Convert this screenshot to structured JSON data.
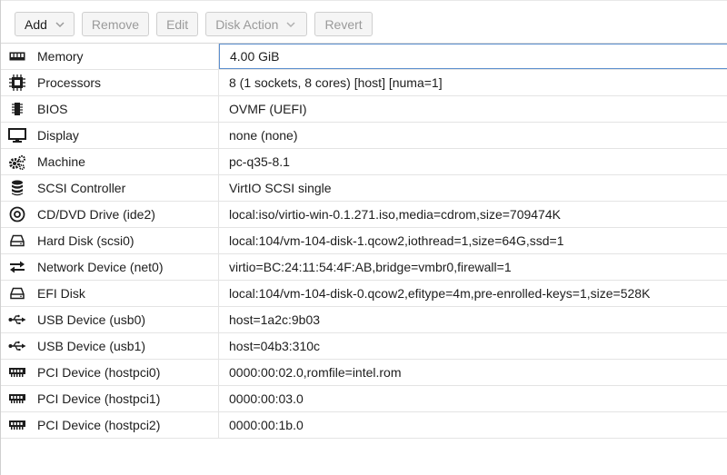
{
  "toolbar": {
    "add_label": "Add",
    "remove_label": "Remove",
    "edit_label": "Edit",
    "disk_action_label": "Disk Action",
    "revert_label": "Revert"
  },
  "hardware": [
    {
      "name": "Memory",
      "value": "4.00 GiB",
      "icon": "memory-icon"
    },
    {
      "name": "Processors",
      "value": "8 (1 sockets, 8 cores) [host] [numa=1]",
      "icon": "cpu-icon"
    },
    {
      "name": "BIOS",
      "value": "OVMF (UEFI)",
      "icon": "chip-icon"
    },
    {
      "name": "Display",
      "value": "none (none)",
      "icon": "monitor-icon"
    },
    {
      "name": "Machine",
      "value": "pc-q35-8.1",
      "icon": "cogs-icon"
    },
    {
      "name": "SCSI Controller",
      "value": "VirtIO SCSI single",
      "icon": "database-icon"
    },
    {
      "name": "CD/DVD Drive (ide2)",
      "value": "local:iso/virtio-win-0.1.271.iso,media=cdrom,size=709474K",
      "icon": "cdrom-icon"
    },
    {
      "name": "Hard Disk (scsi0)",
      "value": "local:104/vm-104-disk-1.qcow2,iothread=1,size=64G,ssd=1",
      "icon": "hdd-icon"
    },
    {
      "name": "Network Device (net0)",
      "value": "virtio=BC:24:11:54:4F:AB,bridge=vmbr0,firewall=1",
      "icon": "exchange-icon"
    },
    {
      "name": "EFI Disk",
      "value": "local:104/vm-104-disk-0.qcow2,efitype=4m,pre-enrolled-keys=1,size=528K",
      "icon": "hdd-icon"
    },
    {
      "name": "USB Device (usb0)",
      "value": "host=1a2c:9b03",
      "icon": "usb-icon"
    },
    {
      "name": "USB Device (usb1)",
      "value": "host=04b3:310c",
      "icon": "usb-icon"
    },
    {
      "name": "PCI Device (hostpci0)",
      "value": "0000:00:02.0,romfile=intel.rom",
      "icon": "pci-card-icon"
    },
    {
      "name": "PCI Device (hostpci1)",
      "value": "0000:00:03.0",
      "icon": "pci-card-icon"
    },
    {
      "name": "PCI Device (hostpci2)",
      "value": "0000:00:1b.0",
      "icon": "pci-card-icon"
    }
  ]
}
